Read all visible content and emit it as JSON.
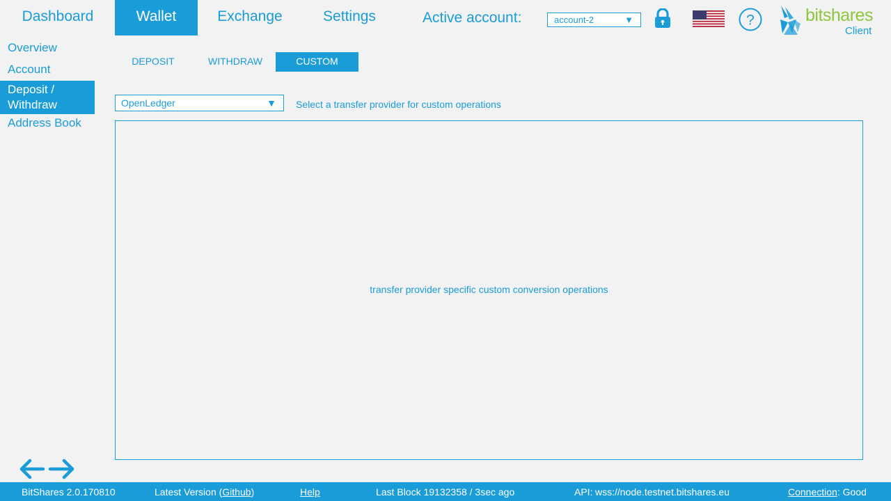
{
  "top_nav": {
    "tabs": [
      {
        "label": "Dashboard",
        "active": false
      },
      {
        "label": "Wallet",
        "active": true
      },
      {
        "label": "Exchange",
        "active": false
      },
      {
        "label": "Settings",
        "active": false
      }
    ],
    "active_account_label": "Active account:",
    "account_select": {
      "value": "account-2"
    },
    "lock_icon": "lock-icon",
    "language_icon": "us-flag-icon",
    "help_icon": "help-icon"
  },
  "logo": {
    "name": "bitshares",
    "sub": "Client"
  },
  "sidebar": {
    "items": [
      {
        "label": "Overview",
        "active": false
      },
      {
        "label": "Account",
        "active": false
      },
      {
        "label": "Deposit / Withdraw",
        "active": true
      },
      {
        "label": "Address Book",
        "active": false
      }
    ]
  },
  "sub_tabs": [
    {
      "label": "DEPOSIT",
      "active": false
    },
    {
      "label": "WITHDRAW",
      "active": false
    },
    {
      "label": "CUSTOM",
      "active": true
    }
  ],
  "provider": {
    "value": "OpenLedger",
    "hint": "Select a transfer provider  for custom operations"
  },
  "content": {
    "placeholder": "transfer provider  specific custom conversion operations"
  },
  "footer": {
    "version": "BitShares 2.0.170810",
    "latest_prefix": "Latest Version (",
    "latest_link": "Github",
    "latest_suffix": ")",
    "help": "Help",
    "last_block": "Last Block 19132358  / 3sec ago",
    "api_label": "API:",
    "api_value": "wss://node.testnet.bitshares.eu",
    "connection_label": "Connection",
    "connection_value": ": Good"
  },
  "colors": {
    "accent": "#1a9cd8",
    "logo_green": "#8cc63f",
    "background": "#f2f2f2"
  }
}
